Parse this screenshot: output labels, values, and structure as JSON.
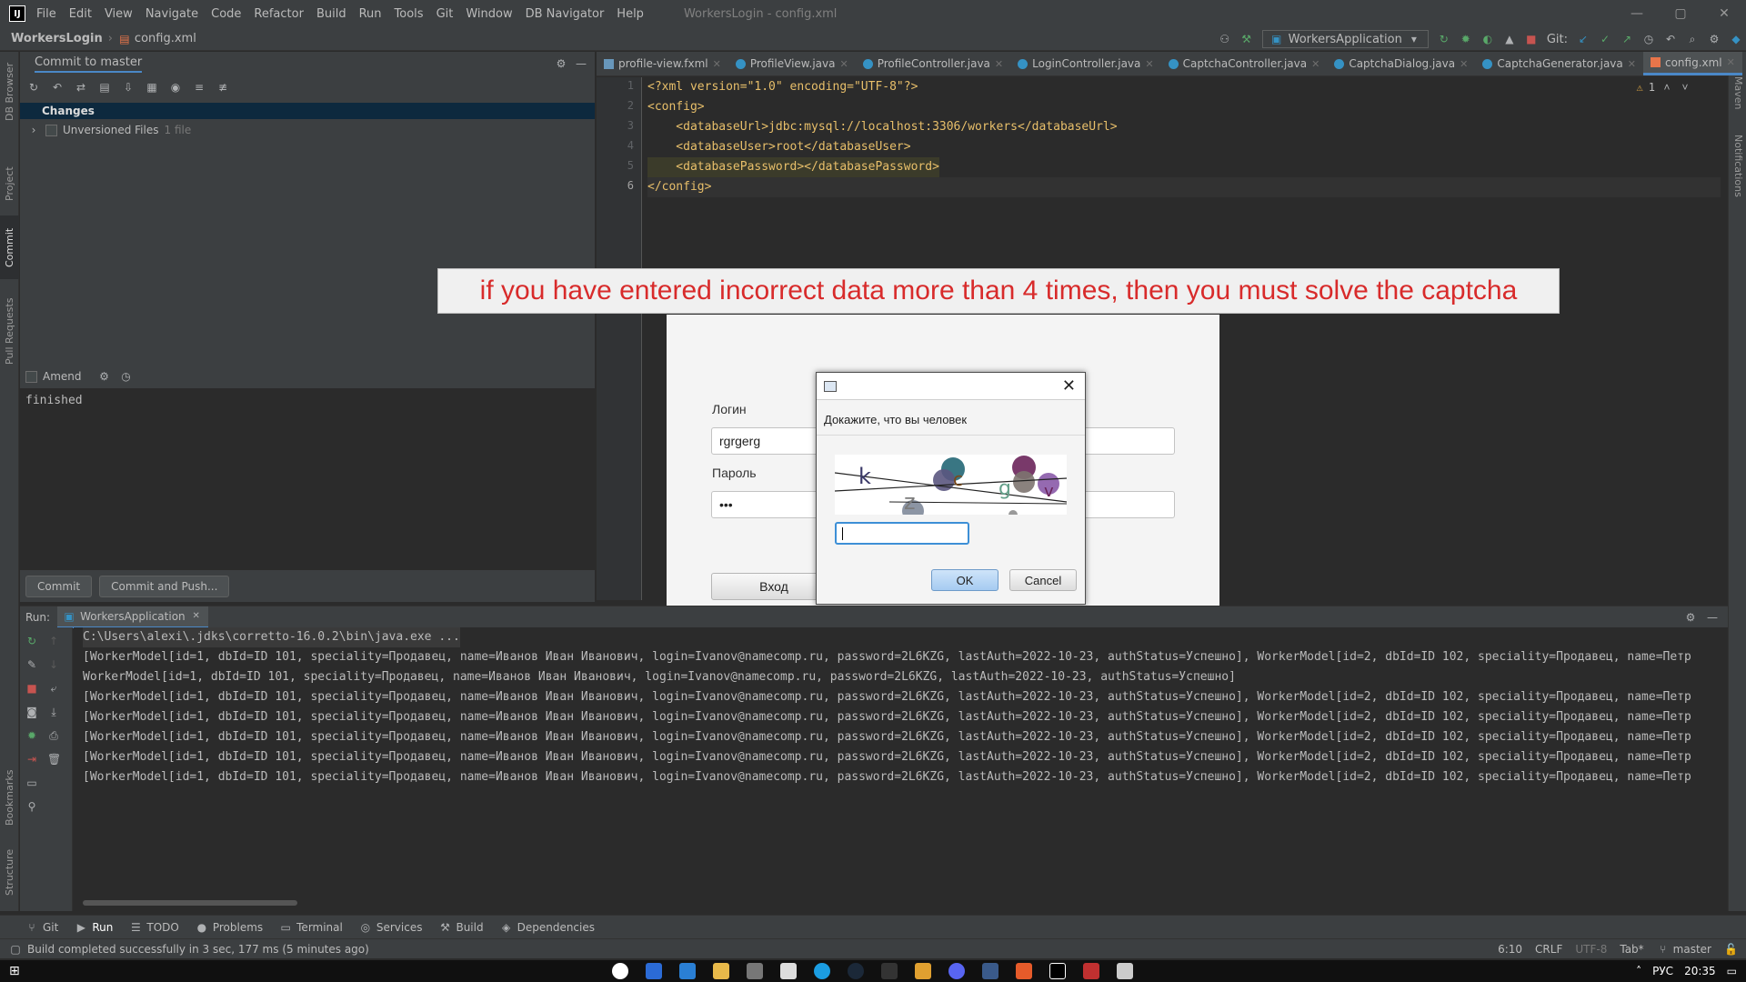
{
  "window": {
    "title": "WorkersLogin - config.xml",
    "controls": [
      "—",
      "▢",
      "✕"
    ]
  },
  "menu": [
    "File",
    "Edit",
    "View",
    "Navigate",
    "Code",
    "Refactor",
    "Build",
    "Run",
    "Tools",
    "Git",
    "Window",
    "DB Navigator",
    "Help"
  ],
  "navbar": {
    "project": "WorkersLogin",
    "file": "config.xml",
    "run_config": "WorkersApplication",
    "git_label": "Git:"
  },
  "left_stripe": [
    "DB Browser",
    "Project",
    "Commit",
    "Pull Requests",
    "Bookmarks",
    "Structure"
  ],
  "right_stripe": [
    "Maven",
    "Notifications"
  ],
  "commit_panel": {
    "title": "Commit to master",
    "changes_label": "Changes",
    "unversioned_label": "Unversioned Files",
    "unversioned_count": "1 file",
    "amend_label": "Amend",
    "message": "finished",
    "commit_button": "Commit",
    "commit_push_button": "Commit and Push..."
  },
  "editor": {
    "tabs": [
      {
        "label": "profile-view.fxml",
        "kind": "fxml",
        "active": false
      },
      {
        "label": "ProfileView.java",
        "kind": "class",
        "active": false
      },
      {
        "label": "ProfileController.java",
        "kind": "class",
        "active": false
      },
      {
        "label": "LoginController.java",
        "kind": "class",
        "active": false
      },
      {
        "label": "CaptchaController.java",
        "kind": "class",
        "active": false
      },
      {
        "label": "CaptchaDialog.java",
        "kind": "class",
        "active": false
      },
      {
        "label": "CaptchaGenerator.java",
        "kind": "class",
        "active": false
      },
      {
        "label": "config.xml",
        "kind": "xml",
        "active": true
      }
    ],
    "warnings": "1",
    "line_numbers": [
      "1",
      "2",
      "3",
      "4",
      "5",
      "6"
    ],
    "lines": {
      "l1": "<?xml version=\"1.0\" encoding=\"UTF-8\"?>",
      "l2": "<config>",
      "l3": "    <databaseUrl>jdbc:mysql://localhost:3306/workers</databaseUrl>",
      "l4": "    <databaseUser>root</databaseUser>",
      "l5": "    <databasePassword></databasePassword>",
      "l6": "</config>"
    }
  },
  "caption": "if you have entered incorrect data more than 4 times, then you must solve the captcha",
  "login_window": {
    "login_label": "Логин",
    "login_value": "rgrgerg",
    "password_label": "Пароль",
    "password_value": "•••",
    "enter_button": "Вход"
  },
  "captcha_dialog": {
    "prompt": "Докажите, что вы человек",
    "close_glyph": "✕",
    "image_letters": [
      "k",
      "z",
      "c",
      "g",
      "v"
    ],
    "input_value": "",
    "ok_button": "OK",
    "cancel_button": "Cancel"
  },
  "run_panel": {
    "label": "Run:",
    "tab": "WorkersApplication",
    "lines": [
      "C:\\Users\\alexi\\.jdks\\corretto-16.0.2\\bin\\java.exe ...",
      "[WorkerModel[id=1, dbId=ID 101, speciality=Продавец, name=Иванов Иван Иванович, login=Ivanov@namecomp.ru, password=2L6KZG, lastAuth=2022-10-23, authStatus=Успешно], WorkerModel[id=2, dbId=ID 102, speciality=Продавец, name=Петр",
      "WorkerModel[id=1, dbId=ID 101, speciality=Продавец, name=Иванов Иван Иванович, login=Ivanov@namecomp.ru, password=2L6KZG, lastAuth=2022-10-23, authStatus=Успешно]",
      "[WorkerModel[id=1, dbId=ID 101, speciality=Продавец, name=Иванов Иван Иванович, login=Ivanov@namecomp.ru, password=2L6KZG, lastAuth=2022-10-23, authStatus=Успешно], WorkerModel[id=2, dbId=ID 102, speciality=Продавец, name=Петр",
      "[WorkerModel[id=1, dbId=ID 101, speciality=Продавец, name=Иванов Иван Иванович, login=Ivanov@namecomp.ru, password=2L6KZG, lastAuth=2022-10-23, authStatus=Успешно], WorkerModel[id=2, dbId=ID 102, speciality=Продавец, name=Петр",
      "[WorkerModel[id=1, dbId=ID 101, speciality=Продавец, name=Иванов Иван Иванович, login=Ivanov@namecomp.ru, password=2L6KZG, lastAuth=2022-10-23, authStatus=Успешно], WorkerModel[id=2, dbId=ID 102, speciality=Продавец, name=Петр",
      "[WorkerModel[id=1, dbId=ID 101, speciality=Продавец, name=Иванов Иван Иванович, login=Ivanov@namecomp.ru, password=2L6KZG, lastAuth=2022-10-23, authStatus=Успешно], WorkerModel[id=2, dbId=ID 102, speciality=Продавец, name=Петр",
      "[WorkerModel[id=1, dbId=ID 101, speciality=Продавец, name=Иванов Иван Иванович, login=Ivanov@namecomp.ru, password=2L6KZG, lastAuth=2022-10-23, authStatus=Успешно], WorkerModel[id=2, dbId=ID 102, speciality=Продавец, name=Петр"
    ]
  },
  "tool_tabs": [
    {
      "label": "Git",
      "icon": "git-icon",
      "active": false
    },
    {
      "label": "Run",
      "icon": "run-icon",
      "active": true
    },
    {
      "label": "TODO",
      "icon": "todo-icon",
      "active": false
    },
    {
      "label": "Problems",
      "icon": "problems-icon",
      "active": false
    },
    {
      "label": "Terminal",
      "icon": "terminal-icon",
      "active": false
    },
    {
      "label": "Services",
      "icon": "services-icon",
      "active": false
    },
    {
      "label": "Build",
      "icon": "build-icon",
      "active": false
    },
    {
      "label": "Dependencies",
      "icon": "dependencies-icon",
      "active": false
    }
  ],
  "status_bar": {
    "message": "Build completed successfully in 3 sec, 177 ms (5 minutes ago)",
    "position": "6:10",
    "line_sep": "CRLF",
    "encoding": "UTF-8",
    "indent": "Tab*",
    "branch": "master"
  },
  "taskbar": {
    "lang": "РУС",
    "time": "20:35"
  },
  "colors": {
    "accent": "#4a88c7",
    "caption_text": "#d82b2b",
    "xml_tag": "#e8bf6a",
    "xml_string": "#6a8759"
  }
}
